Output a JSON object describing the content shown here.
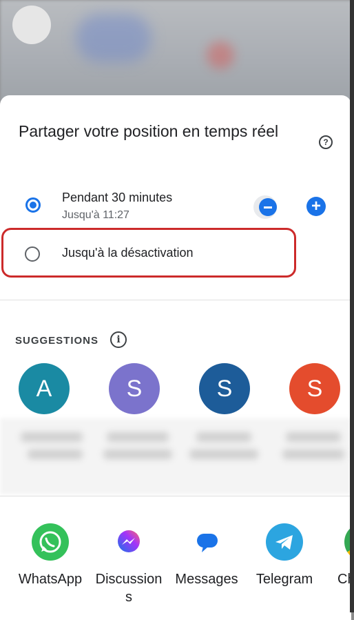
{
  "dialog": {
    "title": "Partager votre position en temps réel",
    "help_icon": "help-circle-icon",
    "options": [
      {
        "label": "Pendant 30 minutes",
        "sublabel": "Jusqu'à 11:27",
        "selected": true
      },
      {
        "label": "Jusqu'à la désactivation",
        "selected": false
      }
    ],
    "duration_controls": {
      "minus_icon": "minus-circle-icon",
      "plus_icon": "plus-circle-icon"
    }
  },
  "suggestions": {
    "title": "SUGGESTIONS",
    "info_icon": "info-icon",
    "contacts": [
      {
        "initial": "A",
        "color": "#1a8aa3"
      },
      {
        "initial": "S",
        "color": "#7b73cc"
      },
      {
        "initial": "S",
        "color": "#1d5c99"
      },
      {
        "initial": "S",
        "color": "#e44c2d"
      }
    ]
  },
  "apps": [
    {
      "label": "WhatsApp",
      "icon": "whatsapp-icon",
      "color": "#34c15a"
    },
    {
      "label": "Discussions",
      "icon": "messenger-icon",
      "color": "#ffffff"
    },
    {
      "label": "Messages",
      "icon": "messages-icon",
      "color": "#ffffff"
    },
    {
      "label": "Telegram",
      "icon": "telegram-icon",
      "color": "#2ca5e0"
    },
    {
      "label": "Ch",
      "icon": "chrome-icon",
      "color": "#ffffff"
    }
  ],
  "colors": {
    "accent": "#1a73e8",
    "highlight": "#cc2a2a"
  }
}
